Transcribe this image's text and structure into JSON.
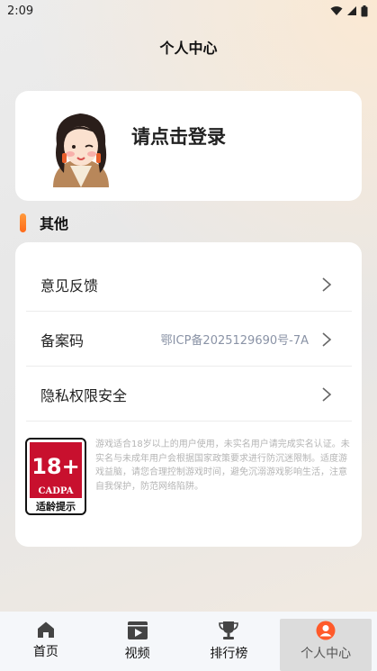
{
  "status_bar": {
    "time": "2:09"
  },
  "page": {
    "title": "个人中心"
  },
  "login": {
    "prompt": "请点击登录"
  },
  "section": {
    "title": "其他"
  },
  "menu": {
    "items": [
      {
        "label": "意见反馈",
        "value": ""
      },
      {
        "label": "备案码",
        "value": "鄂ICP备2025129690号-7A"
      },
      {
        "label": "隐私权限安全",
        "value": ""
      }
    ]
  },
  "age_rating": {
    "badge_number": "18+",
    "badge_org": "CADPA",
    "badge_caption": "适龄提示",
    "notice": "游戏适合18岁以上的用户使用，未实名用户请完成实名认证。未实名与未成年用户会根据国家政策要求进行防沉迷限制。适度游戏益脑，请您合理控制游戏时间，避免沉溺游戏影响生活，注意自我保护，防范网络陷阱。"
  },
  "tabs": [
    {
      "label": "首页",
      "icon": "home-icon",
      "active": false
    },
    {
      "label": "视频",
      "icon": "video-icon",
      "active": false
    },
    {
      "label": "排行榜",
      "icon": "trophy-icon",
      "active": false
    },
    {
      "label": "个人中心",
      "icon": "user-icon",
      "active": true
    }
  ],
  "colors": {
    "accent": "#ff6a1a",
    "badge_red": "#c8102e",
    "active_user": "#ff5a2a"
  }
}
